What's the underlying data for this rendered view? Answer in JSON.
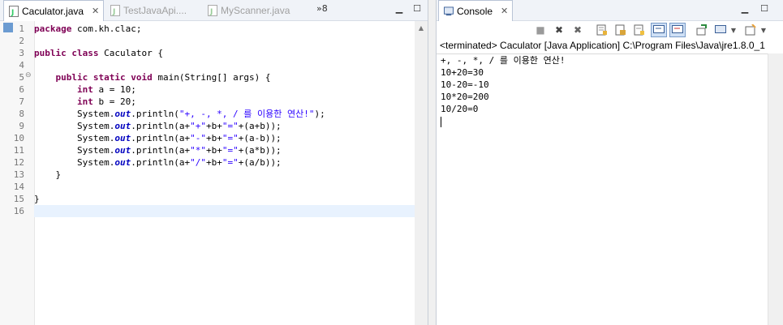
{
  "editor": {
    "tabs": [
      {
        "label": "Caculator.java",
        "active": true
      },
      {
        "label": "TestJavaApi....",
        "active": false
      },
      {
        "label": "MyScanner.java",
        "active": false
      }
    ],
    "overflow_label": "»8",
    "line_numbers": [
      "1",
      "2",
      "3",
      "4",
      "5",
      "6",
      "7",
      "8",
      "9",
      "10",
      "11",
      "12",
      "13",
      "14",
      "15",
      "16"
    ],
    "code": [
      [
        {
          "t": "package",
          "c": "kw"
        },
        {
          "t": " com.kh.clac;",
          "c": ""
        }
      ],
      [],
      [
        {
          "t": "public",
          "c": "kw"
        },
        {
          "t": " ",
          "c": ""
        },
        {
          "t": "class",
          "c": "kw"
        },
        {
          "t": " Caculator {",
          "c": ""
        }
      ],
      [],
      [
        {
          "t": "    ",
          "c": ""
        },
        {
          "t": "public",
          "c": "kw"
        },
        {
          "t": " ",
          "c": ""
        },
        {
          "t": "static",
          "c": "kw"
        },
        {
          "t": " ",
          "c": ""
        },
        {
          "t": "void",
          "c": "kw"
        },
        {
          "t": " main(String[] args) {",
          "c": ""
        }
      ],
      [
        {
          "t": "        ",
          "c": ""
        },
        {
          "t": "int",
          "c": "kw"
        },
        {
          "t": " a = 10;",
          "c": ""
        }
      ],
      [
        {
          "t": "        ",
          "c": ""
        },
        {
          "t": "int",
          "c": "kw"
        },
        {
          "t": " b = 20;",
          "c": ""
        }
      ],
      [
        {
          "t": "        System.",
          "c": ""
        },
        {
          "t": "out",
          "c": "fld"
        },
        {
          "t": ".println(",
          "c": ""
        },
        {
          "t": "\"+, -, *, / 를 이용한 연산!\"",
          "c": "str"
        },
        {
          "t": ");",
          "c": ""
        }
      ],
      [
        {
          "t": "        System.",
          "c": ""
        },
        {
          "t": "out",
          "c": "fld"
        },
        {
          "t": ".println(a+",
          "c": ""
        },
        {
          "t": "\"+\"",
          "c": "str"
        },
        {
          "t": "+b+",
          "c": ""
        },
        {
          "t": "\"=\"",
          "c": "str"
        },
        {
          "t": "+(a+b));",
          "c": ""
        }
      ],
      [
        {
          "t": "        System.",
          "c": ""
        },
        {
          "t": "out",
          "c": "fld"
        },
        {
          "t": ".println(a+",
          "c": ""
        },
        {
          "t": "\"-\"",
          "c": "str"
        },
        {
          "t": "+b+",
          "c": ""
        },
        {
          "t": "\"=\"",
          "c": "str"
        },
        {
          "t": "+(a-b));",
          "c": ""
        }
      ],
      [
        {
          "t": "        System.",
          "c": ""
        },
        {
          "t": "out",
          "c": "fld"
        },
        {
          "t": ".println(a+",
          "c": ""
        },
        {
          "t": "\"*\"",
          "c": "str"
        },
        {
          "t": "+b+",
          "c": ""
        },
        {
          "t": "\"=\"",
          "c": "str"
        },
        {
          "t": "+(a*b));",
          "c": ""
        }
      ],
      [
        {
          "t": "        System.",
          "c": ""
        },
        {
          "t": "out",
          "c": "fld"
        },
        {
          "t": ".println(a+",
          "c": ""
        },
        {
          "t": "\"/\"",
          "c": "str"
        },
        {
          "t": "+b+",
          "c": ""
        },
        {
          "t": "\"=\"",
          "c": "str"
        },
        {
          "t": "+(a/b));",
          "c": ""
        }
      ],
      [
        {
          "t": "    }",
          "c": ""
        }
      ],
      [],
      [
        {
          "t": "}",
          "c": ""
        }
      ],
      []
    ],
    "current_line": 16
  },
  "console": {
    "tab_label": "Console",
    "status": "<terminated> Caculator [Java Application] C:\\Program Files\\Java\\jre1.8.0_1",
    "output": [
      "+, -, *, / 를 이용한 연산!",
      "10+20=30",
      "10-20=-10",
      "10*20=200",
      "10/20=0"
    ],
    "toolbar_icons": [
      "terminate-icon",
      "remove-launch-icon",
      "remove-all-icon",
      "clear-console-icon",
      "scroll-lock-icon",
      "word-wrap-icon",
      "show-on-stdout-icon",
      "show-on-stderr-icon",
      "pin-console-icon",
      "display-console-icon",
      "open-console-icon"
    ]
  }
}
